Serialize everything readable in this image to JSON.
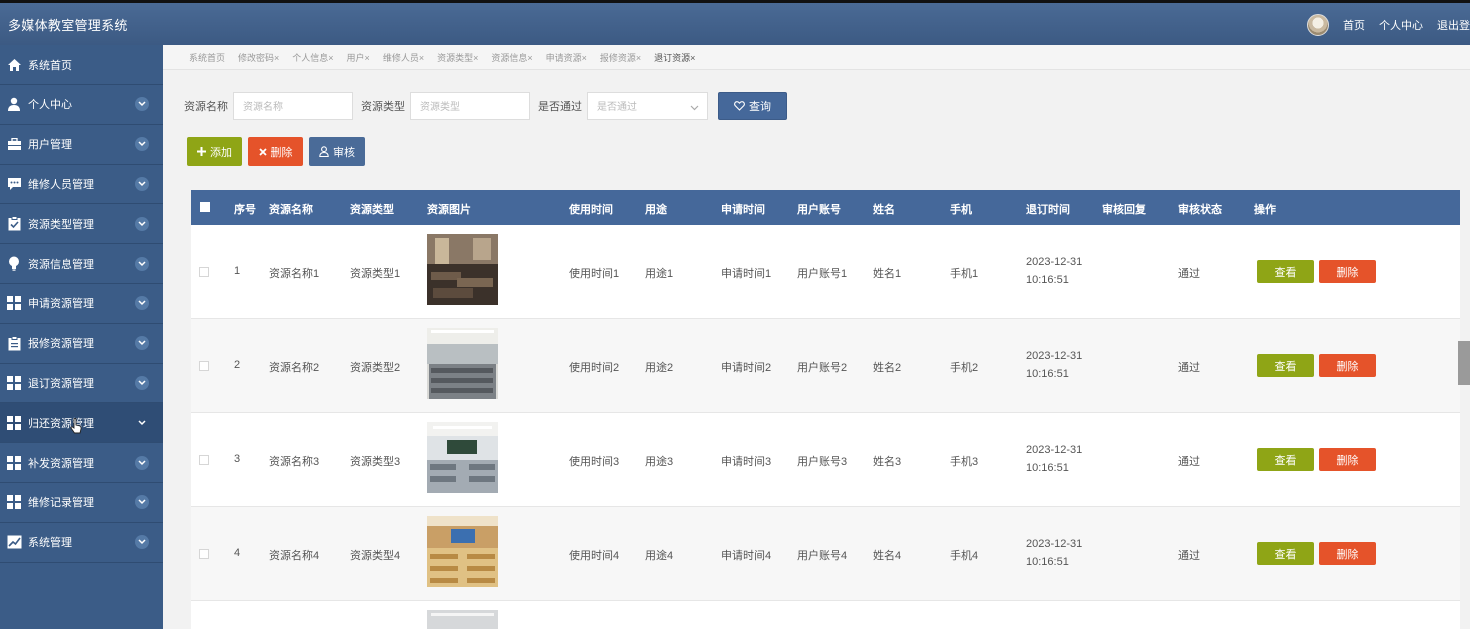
{
  "app": {
    "title": "多媒体教室管理系统"
  },
  "header": {
    "links": [
      "首页",
      "个人中心",
      "退出登"
    ]
  },
  "sidebar": {
    "items": [
      {
        "label": "系统首页",
        "icon": "home-icon"
      },
      {
        "label": "个人中心",
        "icon": "user-icon"
      },
      {
        "label": "用户管理",
        "icon": "briefcase-icon"
      },
      {
        "label": "维修人员管理",
        "icon": "chat-icon"
      },
      {
        "label": "资源类型管理",
        "icon": "clipboard-check-icon"
      },
      {
        "label": "资源信息管理",
        "icon": "bulb-icon"
      },
      {
        "label": "申请资源管理",
        "icon": "grid-icon"
      },
      {
        "label": "报修资源管理",
        "icon": "clipboard-icon"
      },
      {
        "label": "退订资源管理",
        "icon": "grid-icon"
      },
      {
        "label": "归还资源管理",
        "icon": "grid-icon"
      },
      {
        "label": "补发资源管理",
        "icon": "grid-icon"
      },
      {
        "label": "维修记录管理",
        "icon": "grid-icon"
      },
      {
        "label": "系统管理",
        "icon": "chart-icon"
      }
    ]
  },
  "tabs": [
    "系统首页",
    "修改密码×",
    "个人信息×",
    "用户×",
    "维修人员×",
    "资源类型×",
    "资源信息×",
    "申请资源×",
    "报修资源×",
    "退订资源×"
  ],
  "search": {
    "name_label": "资源名称",
    "name_placeholder": "资源名称",
    "type_label": "资源类型",
    "type_placeholder": "资源类型",
    "pass_label": "是否通过",
    "pass_placeholder": "是否通过",
    "button": "查询"
  },
  "actions": {
    "add": "添加",
    "delete": "删除",
    "audit": "审核"
  },
  "table": {
    "headers": [
      "序号",
      "资源名称",
      "资源类型",
      "资源图片",
      "使用时间",
      "用途",
      "申请时间",
      "用户账号",
      "姓名",
      "手机",
      "退订时间",
      "审核回复",
      "审核状态",
      "操作"
    ],
    "rows": [
      {
        "no": "1",
        "name": "资源名称1",
        "type": "资源类型1",
        "use_time": "使用时间1",
        "purpose": "用途1",
        "apply_time": "申请时间1",
        "account": "用户账号1",
        "real_name": "姓名1",
        "phone": "手机1",
        "cancel_date": "2023-12-31",
        "cancel_clock": "10:16:51",
        "status": "通过"
      },
      {
        "no": "2",
        "name": "资源名称2",
        "type": "资源类型2",
        "use_time": "使用时间2",
        "purpose": "用途2",
        "apply_time": "申请时间2",
        "account": "用户账号2",
        "real_name": "姓名2",
        "phone": "手机2",
        "cancel_date": "2023-12-31",
        "cancel_clock": "10:16:51",
        "status": "通过"
      },
      {
        "no": "3",
        "name": "资源名称3",
        "type": "资源类型3",
        "use_time": "使用时间3",
        "purpose": "用途3",
        "apply_time": "申请时间3",
        "account": "用户账号3",
        "real_name": "姓名3",
        "phone": "手机3",
        "cancel_date": "2023-12-31",
        "cancel_clock": "10:16:51",
        "status": "通过"
      },
      {
        "no": "4",
        "name": "资源名称4",
        "type": "资源类型4",
        "use_time": "使用时间4",
        "purpose": "用途4",
        "apply_time": "申请时间4",
        "account": "用户账号4",
        "real_name": "姓名4",
        "phone": "手机4",
        "cancel_date": "2023-12-31",
        "cancel_clock": "10:16:51",
        "status": "通过"
      }
    ],
    "row_actions": {
      "view": "查看",
      "delete": "删除"
    }
  },
  "colors": {
    "header_bg": "#3c5a83",
    "sidebar_bg": "#3b5c87",
    "table_head": "#45689a",
    "green": "#8fa516",
    "red": "#e5532a"
  }
}
